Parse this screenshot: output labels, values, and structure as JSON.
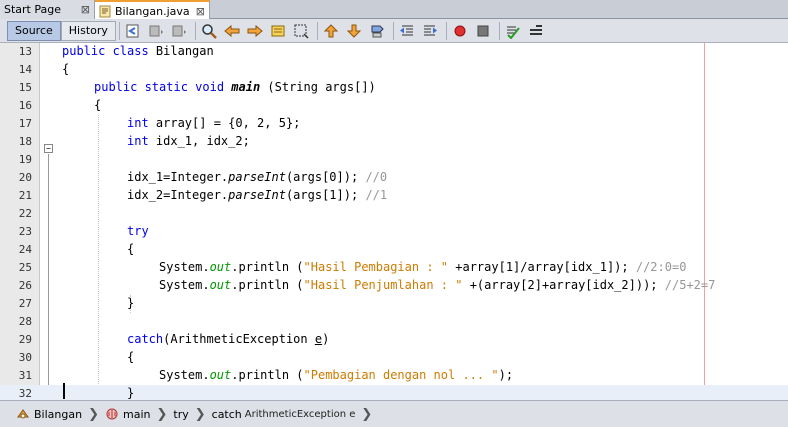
{
  "tabs": [
    {
      "label": "Start Page",
      "close": "⊠"
    },
    {
      "label": "Bilangan.java",
      "close": "⊠"
    }
  ],
  "toolbar": {
    "source_label": "Source",
    "history_label": "History"
  },
  "editor": {
    "lines": [
      {
        "num": "13"
      },
      {
        "num": "14"
      },
      {
        "num": "15"
      },
      {
        "num": "16"
      },
      {
        "num": "17"
      },
      {
        "num": "18"
      },
      {
        "num": "19"
      },
      {
        "num": "20"
      },
      {
        "num": "21"
      },
      {
        "num": "22"
      },
      {
        "num": "23"
      },
      {
        "num": "24"
      },
      {
        "num": "25"
      },
      {
        "num": "26"
      },
      {
        "num": "27"
      },
      {
        "num": "28"
      },
      {
        "num": "29"
      },
      {
        "num": "30"
      },
      {
        "num": "31"
      },
      {
        "num": "32"
      }
    ],
    "fold_marker": "−",
    "code": {
      "l13_kw": "public class",
      "l13_name": " Bilangan",
      "l14": "{",
      "l15_kw": "public static void",
      "l15_method": "main",
      "l15_rest": " (String args[])",
      "l16": "{",
      "l17_kw": "int",
      "l17_rest": " array[] = {0, 2, 5};",
      "l18_kw": "int",
      "l18_rest": " idx_1, idx_2;",
      "l20_a": "idx_1=Integer.",
      "l20_method": "parseInt",
      "l20_b": "(args[0]); ",
      "l20_cm": "//0",
      "l21_a": "idx_2=Integer.",
      "l21_method": "parseInt",
      "l21_b": "(args[1]); ",
      "l21_cm": "//1",
      "l23_kw": "try",
      "l24": "{",
      "l25_a": "System.",
      "l25_field": "out",
      "l25_b": ".println (",
      "l25_str": "\"Hasil Pembagian : \"",
      "l25_c": " +array[1]/array[idx_1]); ",
      "l25_cm": "//2:0=0",
      "l26_a": "System.",
      "l26_field": "out",
      "l26_b": ".println (",
      "l26_str": "\"Hasil Penjumlahan : \"",
      "l26_c": " +(array[2]+array[idx_2])); ",
      "l26_cm": "//5+2=7",
      "l27": "}",
      "l29_kw": "catch",
      "l29_a": "(ArithmeticException ",
      "l29_var": "e",
      "l29_b": ")",
      "l30": "{",
      "l31_a": "System.",
      "l31_field": "out",
      "l31_b": ".println (",
      "l31_str": "\"Pembagian dengan nol ... \"",
      "l31_c": ");",
      "l32": "}"
    }
  },
  "breadcrumbs": [
    {
      "label": "Bilangan"
    },
    {
      "label": "main"
    },
    {
      "label": "try"
    },
    {
      "label": "catch",
      "sub": "ArithmeticException e"
    }
  ],
  "colors": {
    "keyword": "#0000e6",
    "string": "#ce7b00",
    "comment": "#969696",
    "field": "#009900",
    "margin_line": "#f0a0a0"
  }
}
